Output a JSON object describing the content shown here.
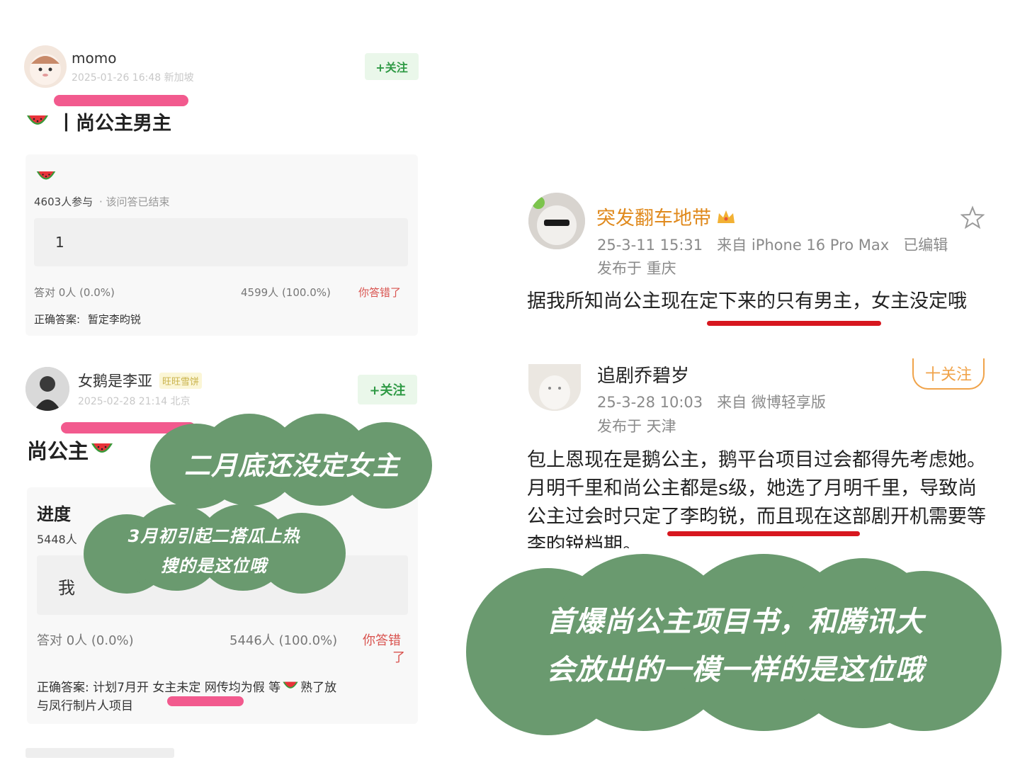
{
  "post1": {
    "username": "momo",
    "meta": "2025-01-26 16:48 新加坡",
    "follow": "+关注",
    "title": "丨尚公主男主",
    "participants": "4603人参与",
    "status": "· 该问答已结束",
    "option": "1",
    "correct_stat": "答对  0人  (0.0%)",
    "wrong_stat": "4599人  (100.0%)",
    "wrong_label": "你答错了",
    "answer_label": "正确答案:",
    "answer_text": "暂定李昀锐"
  },
  "post2": {
    "username": "女鹅是李亚",
    "badge": "旺旺雪饼",
    "meta": "2025-02-28 21:14  北京",
    "follow": "+关注",
    "title": "尚公主",
    "progress_label": "进度",
    "participants": "5448人",
    "option": "我",
    "correct_stat": "答对  0人  (0.0%)",
    "wrong_stat": "5446人  (100.0%)",
    "wrong_label_1": "你答错",
    "wrong_label_2": "了",
    "answer_line1": "正确答案: 计划7月开 女主未定 网传均为假 等",
    "answer_line1_end": "熟了放",
    "answer_line2": "与凤行制片人项目"
  },
  "bubbles": {
    "b1": "二月底还没定女主",
    "b2_line1": "3月初引起二搭瓜上热",
    "b2_line2": "搜的是这位哦",
    "b3_line1": "首爆尚公主项目书，和腾讯大",
    "b3_line2": "会放出的一模一样的是这位哦"
  },
  "comment1": {
    "username": "突发翻车地带",
    "meta": "25-3-11 15:31   来自 iPhone 16 Pro Max   已编辑",
    "location": "发布于 重庆",
    "body": "据我所知尚公主现在定下来的只有男主，女主没定哦"
  },
  "comment2": {
    "username": "追剧乔碧岁",
    "follow": "十关注",
    "meta": "25-3-28 10:03   来自 微博轻享版",
    "location": "发布于 天津",
    "body": "包上恩现在是鹅公主，鹅平台项目过会都得先考虑她。月明千里和尚公主都是s级，她选了月明千里，导致尚公主过会时只定了李昀锐，而且现在这部剧开机需要等李昀锐档期。"
  },
  "colors": {
    "bubble": "#6a9a6f",
    "highlight_pink": "#f25a8e",
    "underline_red": "#d7171f",
    "follow_green": "#2f9a45",
    "username_orange": "#e08a1e"
  },
  "icons": {
    "star": "star-outline-icon",
    "crown": "crown-icon",
    "watermelon": "watermelon-icon"
  }
}
